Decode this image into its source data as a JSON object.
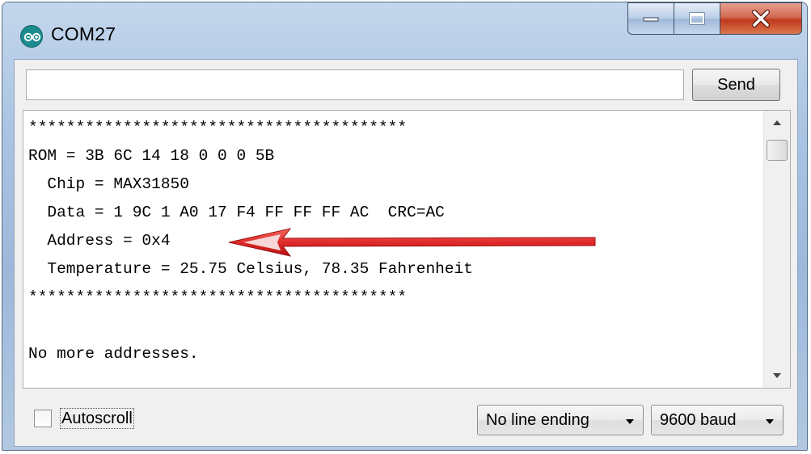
{
  "window": {
    "title": "COM27",
    "app_icon": "arduino-icon",
    "controls": [
      "minimize-icon",
      "maximize-icon",
      "close-icon"
    ]
  },
  "send_bar": {
    "input_value": "",
    "send_label": "Send"
  },
  "output": {
    "lines": [
      "****************************************",
      "ROM = 3B 6C 14 18 0 0 0 5B",
      "  Chip = MAX31850",
      "  Data = 1 9C 1 A0 17 F4 FF FF FF AC  CRC=AC",
      "  Address = 0x4",
      "  Temperature = 25.75 Celsius, 78.35 Fahrenheit",
      "****************************************",
      "",
      "No more addresses."
    ],
    "annotation_arrow_color": "#e02a2a"
  },
  "bottom": {
    "autoscroll_label": "Autoscroll",
    "autoscroll_checked": false,
    "line_ending": "No line ending",
    "baud": "9600 baud"
  }
}
